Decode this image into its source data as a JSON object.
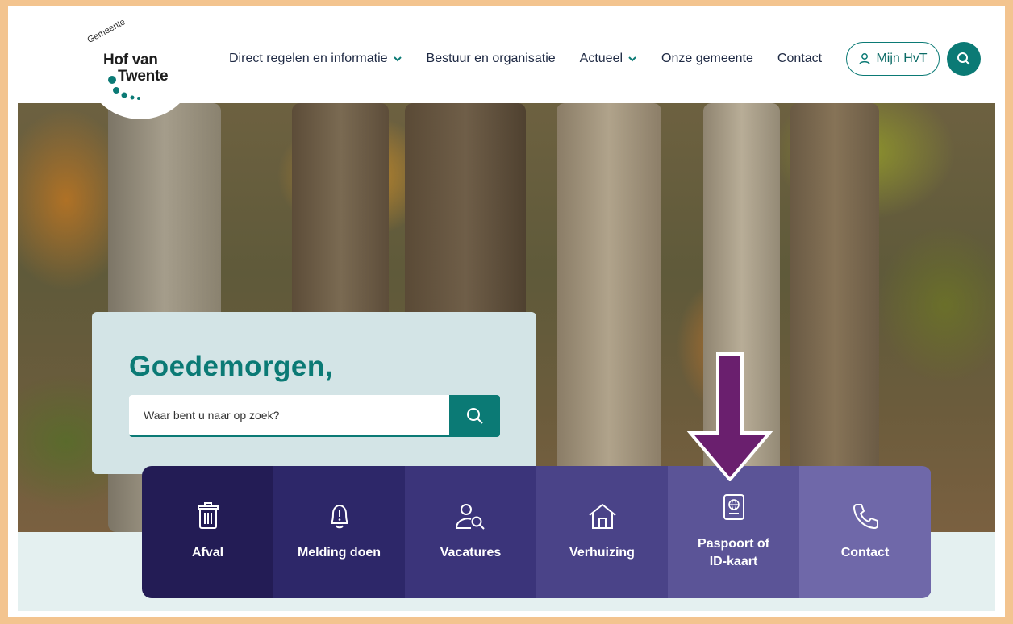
{
  "logo": {
    "small": "Gemeente",
    "line1": "Hof van",
    "line2": "Twente"
  },
  "nav": {
    "items": [
      {
        "label": "Direct regelen en informatie",
        "has_dropdown": true
      },
      {
        "label": "Bestuur en organisatie",
        "has_dropdown": false
      },
      {
        "label": "Actueel",
        "has_dropdown": true
      },
      {
        "label": "Onze gemeente",
        "has_dropdown": false
      },
      {
        "label": "Contact",
        "has_dropdown": false
      }
    ],
    "account_label": "Mijn HvT",
    "search_icon": "search-icon"
  },
  "hero": {
    "greeting": "Goedemorgen,",
    "search_placeholder": "Waar bent u naar op zoek?"
  },
  "tiles": [
    {
      "label": "Afval",
      "icon": "trash-icon",
      "color": "#231c55"
    },
    {
      "label": "Melding doen",
      "icon": "bell-alert-icon",
      "color": "#2d2769"
    },
    {
      "label": "Vacatures",
      "icon": "user-search-icon",
      "color": "#3b347a"
    },
    {
      "label": "Verhuizing",
      "icon": "house-icon",
      "color": "#4a4388"
    },
    {
      "label": "Paspoort of ID-kaart",
      "label_line1": "Paspoort of",
      "label_line2": "ID-kaart",
      "icon": "passport-icon",
      "color": "#5b5497"
    },
    {
      "label": "Contact",
      "icon": "phone-icon",
      "color": "#6f68a9"
    }
  ],
  "colors": {
    "accent": "#0b7a75",
    "frame": "#f3c48f",
    "annotation_arrow": "#6a1f6e"
  }
}
